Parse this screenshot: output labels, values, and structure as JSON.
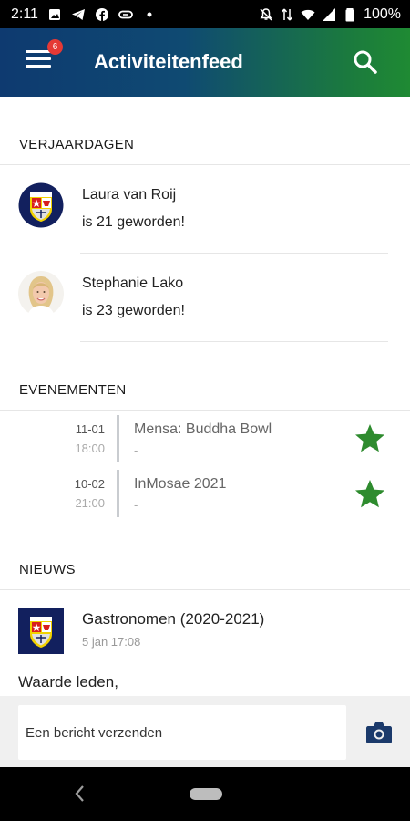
{
  "status_bar": {
    "time": "2:11",
    "battery": "100%"
  },
  "app_bar": {
    "title": "Activiteitenfeed",
    "notification_count": "6",
    "gradient_start": "#0e3a70",
    "gradient_end": "#1f8a33"
  },
  "birthdays": {
    "heading": "VERJAARDAGEN",
    "items": [
      {
        "name": "Laura van Roij",
        "text": "is 21 geworden!",
        "avatar": "crest-icon"
      },
      {
        "name": "Stephanie Lako",
        "text": "is 23 geworden!",
        "avatar": "photo"
      }
    ]
  },
  "events": {
    "heading": "EVENEMENTEN",
    "items": [
      {
        "date": "11-01",
        "time": "18:00",
        "title": "Mensa: Buddha Bowl",
        "subtitle": "-",
        "starred": true
      },
      {
        "date": "10-02",
        "time": "21:00",
        "title": "InMosae 2021",
        "subtitle": "-",
        "starred": true
      }
    ],
    "star_color": "#2e8b2e"
  },
  "news": {
    "heading": "NIEUWS",
    "item": {
      "title": "Gastronomen (2020-2021)",
      "date": "5 jan 17:08",
      "body": "Waarde leden,"
    }
  },
  "composer": {
    "placeholder": "Een bericht verzenden"
  },
  "icons": {
    "menu": "menu-icon",
    "search": "search-icon",
    "camera": "camera-icon",
    "star": "star-icon"
  }
}
